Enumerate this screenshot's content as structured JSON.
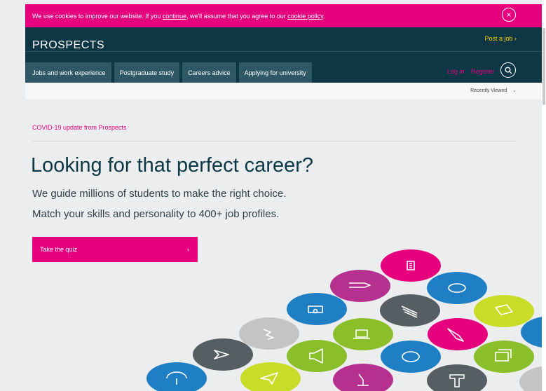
{
  "cookie": {
    "text_before": "We use cookies to improve our website. If you ",
    "continue_link": "continue",
    "text_middle": ", we'll assume that you agree to our ",
    "policy_link": "cookie policy",
    "text_after": ".",
    "close_symbol": "×"
  },
  "header": {
    "logo": "PROSPECTS",
    "post_job": "Post a job ›",
    "nav": [
      "Jobs and work experience",
      "Postgraduate study",
      "Careers advice",
      "Applying for university"
    ],
    "login": "Log in",
    "register": "Register"
  },
  "recent": {
    "label": "Recently Viewed",
    "chevron": "⌄"
  },
  "main": {
    "covid_link": "COVID-19 update from Prospects",
    "headline": "Looking for that perfect career?",
    "subline1": "We guide millions of students to make the right choice.",
    "subline2": "Match your skills and personality to 400+ job profiles.",
    "quiz_label": "Take the quiz",
    "quiz_arrow": "›"
  },
  "icons": [
    {
      "name": "bin-icon",
      "color": "#e6007e"
    },
    {
      "name": "pen-icon",
      "color": "#b5308f"
    },
    {
      "name": "blimp-icon",
      "color": "#1e7fc4"
    },
    {
      "name": "money-icon",
      "color": "#1e7fc4"
    },
    {
      "name": "books-icon",
      "color": "#555e63"
    },
    {
      "name": "ticket-icon",
      "color": "#c8dc28"
    },
    {
      "name": "lightning-icon",
      "color": "#c4c4c4"
    },
    {
      "name": "laptop-icon",
      "color": "#8bbe2b"
    },
    {
      "name": "paintbrush-icon",
      "color": "#e6007e"
    },
    {
      "name": "scissors-icon",
      "color": "#1e7fc4"
    },
    {
      "name": "plane-icon",
      "color": "#555e63"
    },
    {
      "name": "megaphone-icon",
      "color": "#8bbe2b"
    },
    {
      "name": "piggy-bank-icon",
      "color": "#1e7fc4"
    },
    {
      "name": "cards-icon",
      "color": "#8bbe2b"
    },
    {
      "name": "umbrella-icon",
      "color": "#1e7fc4"
    },
    {
      "name": "paper-plane-icon",
      "color": "#c8dc28"
    },
    {
      "name": "microscope-icon",
      "color": "#b5308f"
    },
    {
      "name": "tap-icon",
      "color": "#555e63"
    },
    {
      "name": "guitar-icon",
      "color": "#c4c4c4"
    }
  ]
}
